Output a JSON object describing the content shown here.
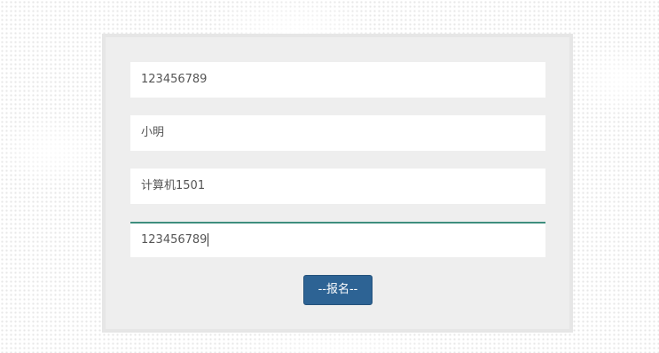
{
  "form": {
    "fields": [
      {
        "value": "123456789"
      },
      {
        "value": "小明"
      },
      {
        "value": "计算机1501"
      },
      {
        "value": "123456789"
      }
    ],
    "submit_label": "--报名--"
  },
  "colors": {
    "button": "#2d6394",
    "focus_border": "#3e8e7e",
    "panel": "#eeeeee"
  }
}
